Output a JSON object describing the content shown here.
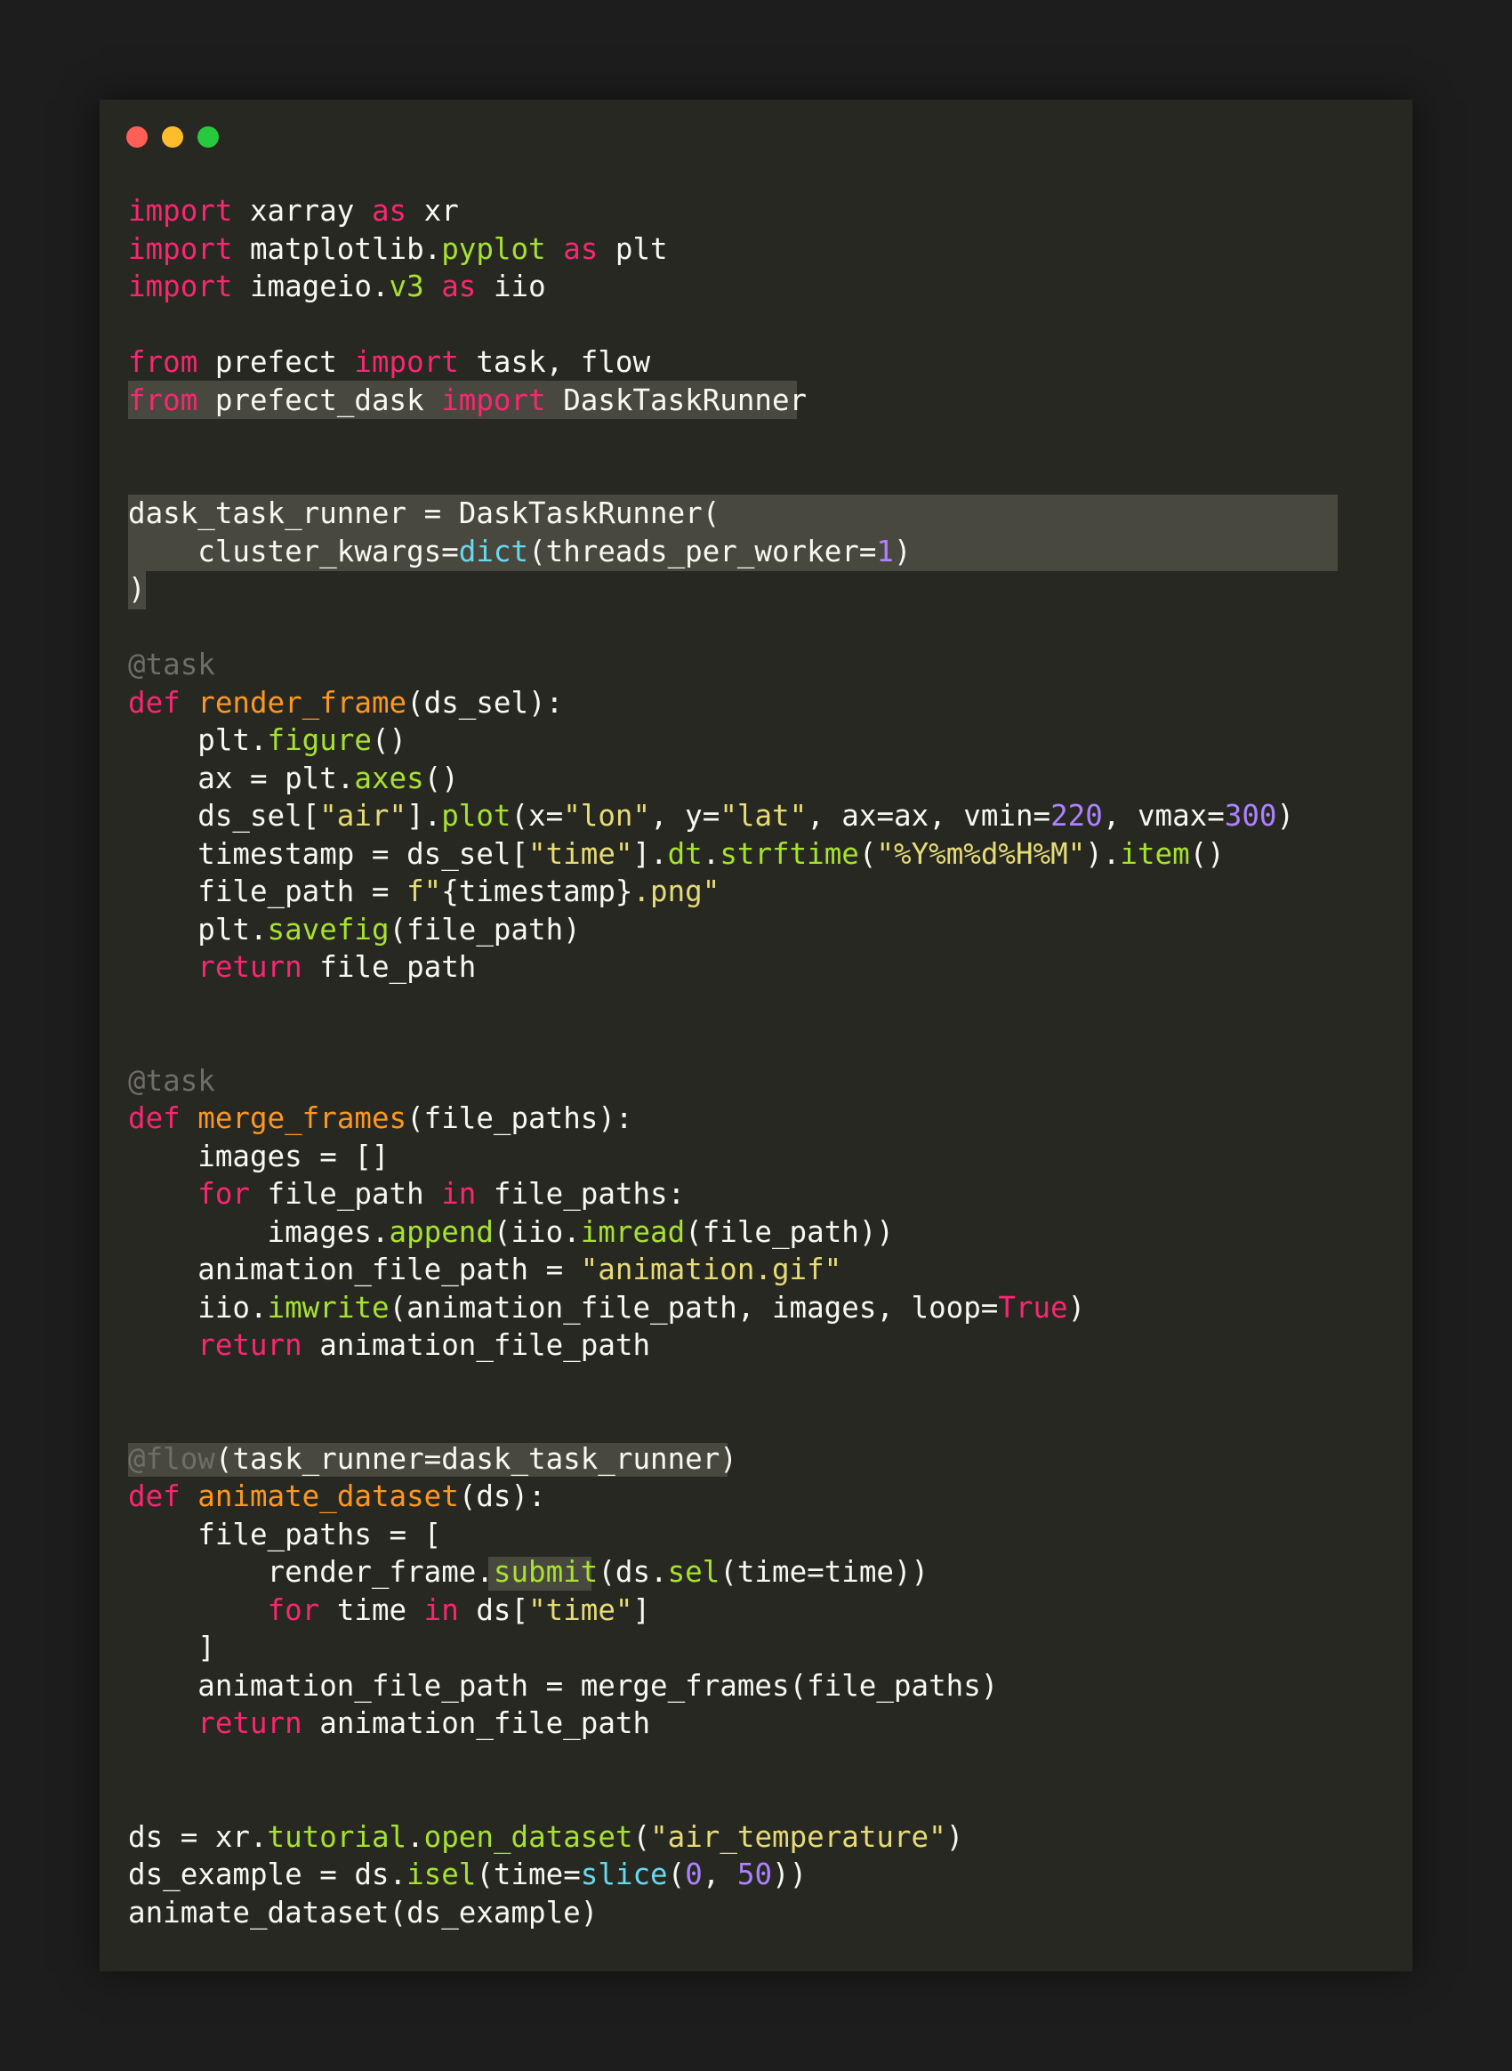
{
  "window": {
    "buttons": [
      "close",
      "minimize",
      "maximize"
    ],
    "colors": {
      "background": "#272822",
      "keyword": "#f92672",
      "function": "#fd971f",
      "attribute": "#a6e22e",
      "string": "#e6db74",
      "number": "#ae81ff",
      "builtin": "#66d9ef",
      "decorator": "#6e6e66",
      "highlight": "#49483e"
    }
  },
  "code": {
    "lines": [
      [
        [
          "kw",
          "import"
        ],
        [
          "p",
          " xarray "
        ],
        [
          "kw",
          "as"
        ],
        [
          "p",
          " xr"
        ]
      ],
      [
        [
          "kw",
          "import"
        ],
        [
          "p",
          " matplotlib."
        ],
        [
          "att",
          "pyplot"
        ],
        [
          "p",
          " "
        ],
        [
          "kw",
          "as"
        ],
        [
          "p",
          " plt"
        ]
      ],
      [
        [
          "kw",
          "import"
        ],
        [
          "p",
          " imageio."
        ],
        [
          "att",
          "v3"
        ],
        [
          "p",
          " "
        ],
        [
          "kw",
          "as"
        ],
        [
          "p",
          " iio"
        ]
      ],
      [],
      [
        [
          "kw",
          "from"
        ],
        [
          "p",
          " prefect "
        ],
        [
          "kw",
          "import"
        ],
        [
          "p",
          " task, flow"
        ]
      ],
      [
        [
          "kw",
          "from"
        ],
        [
          "p",
          " prefect_dask "
        ],
        [
          "kw",
          "import"
        ],
        [
          "p",
          " DaskTaskRunner"
        ]
      ],
      [],
      [],
      [
        [
          "p",
          "dask_task_runner = DaskTaskRunner("
        ]
      ],
      [
        [
          "p",
          "    cluster_kwargs="
        ],
        [
          "bi",
          "dict"
        ],
        [
          "p",
          "(threads_per_worker="
        ],
        [
          "num",
          "1"
        ],
        [
          "p",
          ")"
        ]
      ],
      [
        [
          "p",
          ")"
        ]
      ],
      [],
      [
        [
          "dec",
          "@task"
        ]
      ],
      [
        [
          "kw",
          "def"
        ],
        [
          "p",
          " "
        ],
        [
          "fn",
          "render_frame"
        ],
        [
          "p",
          "(ds_sel):"
        ]
      ],
      [
        [
          "p",
          "    plt."
        ],
        [
          "att",
          "figure"
        ],
        [
          "p",
          "()"
        ]
      ],
      [
        [
          "p",
          "    ax = plt."
        ],
        [
          "att",
          "axes"
        ],
        [
          "p",
          "()"
        ]
      ],
      [
        [
          "p",
          "    ds_sel["
        ],
        [
          "str",
          "\"air\""
        ],
        [
          "p",
          "]."
        ],
        [
          "att",
          "plot"
        ],
        [
          "p",
          "(x="
        ],
        [
          "str",
          "\"lon\""
        ],
        [
          "p",
          ", y="
        ],
        [
          "str",
          "\"lat\""
        ],
        [
          "p",
          ", ax=ax, vmin="
        ],
        [
          "num",
          "220"
        ],
        [
          "p",
          ", vmax="
        ],
        [
          "num",
          "300"
        ],
        [
          "p",
          ")"
        ]
      ],
      [
        [
          "p",
          "    timestamp = ds_sel["
        ],
        [
          "str",
          "\"time\""
        ],
        [
          "p",
          "]."
        ],
        [
          "att",
          "dt"
        ],
        [
          "p",
          "."
        ],
        [
          "att",
          "strftime"
        ],
        [
          "p",
          "("
        ],
        [
          "str",
          "\"%Y%m%d%H%M\""
        ],
        [
          "p",
          ")."
        ],
        [
          "att",
          "item"
        ],
        [
          "p",
          "()"
        ]
      ],
      [
        [
          "p",
          "    file_path = "
        ],
        [
          "str",
          "f\""
        ],
        [
          "p",
          "{timestamp}"
        ],
        [
          "str",
          ".png\""
        ]
      ],
      [
        [
          "p",
          "    plt."
        ],
        [
          "att",
          "savefig"
        ],
        [
          "p",
          "(file_path)"
        ]
      ],
      [
        [
          "p",
          "    "
        ],
        [
          "kw",
          "return"
        ],
        [
          "p",
          " file_path"
        ]
      ],
      [],
      [],
      [
        [
          "dec",
          "@task"
        ]
      ],
      [
        [
          "kw",
          "def"
        ],
        [
          "p",
          " "
        ],
        [
          "fn",
          "merge_frames"
        ],
        [
          "p",
          "(file_paths):"
        ]
      ],
      [
        [
          "p",
          "    images = []"
        ]
      ],
      [
        [
          "p",
          "    "
        ],
        [
          "kw",
          "for"
        ],
        [
          "p",
          " file_path "
        ],
        [
          "kw",
          "in"
        ],
        [
          "p",
          " file_paths:"
        ]
      ],
      [
        [
          "p",
          "        images."
        ],
        [
          "att",
          "append"
        ],
        [
          "p",
          "(iio."
        ],
        [
          "att",
          "imread"
        ],
        [
          "p",
          "(file_path))"
        ]
      ],
      [
        [
          "p",
          "    animation_file_path = "
        ],
        [
          "str",
          "\"animation.gif\""
        ]
      ],
      [
        [
          "p",
          "    iio."
        ],
        [
          "att",
          "imwrite"
        ],
        [
          "p",
          "(animation_file_path, images, loop="
        ],
        [
          "kw",
          "True"
        ],
        [
          "p",
          ")"
        ]
      ],
      [
        [
          "p",
          "    "
        ],
        [
          "kw",
          "return"
        ],
        [
          "p",
          " animation_file_path"
        ]
      ],
      [],
      [],
      [
        [
          "dec",
          "@flow"
        ],
        [
          "p",
          "(task_runner=dask_task_runner)"
        ]
      ],
      [
        [
          "kw",
          "def"
        ],
        [
          "p",
          " "
        ],
        [
          "fn",
          "animate_dataset"
        ],
        [
          "p",
          "(ds):"
        ]
      ],
      [
        [
          "p",
          "    file_paths = ["
        ]
      ],
      [
        [
          "p",
          "        render_frame."
        ],
        [
          "att",
          "submit"
        ],
        [
          "p",
          "(ds."
        ],
        [
          "att",
          "sel"
        ],
        [
          "p",
          "(time=time))"
        ]
      ],
      [
        [
          "p",
          "        "
        ],
        [
          "kw",
          "for"
        ],
        [
          "p",
          " time "
        ],
        [
          "kw",
          "in"
        ],
        [
          "p",
          " ds["
        ],
        [
          "str",
          "\"time\""
        ],
        [
          "p",
          "]"
        ]
      ],
      [
        [
          "p",
          "    ]"
        ]
      ],
      [
        [
          "p",
          "    animation_file_path = merge_frames(file_paths)"
        ]
      ],
      [
        [
          "p",
          "    "
        ],
        [
          "kw",
          "return"
        ],
        [
          "p",
          " animation_file_path"
        ]
      ],
      [],
      [],
      [
        [
          "p",
          "ds = xr."
        ],
        [
          "att",
          "tutorial"
        ],
        [
          "p",
          "."
        ],
        [
          "att",
          "open_dataset"
        ],
        [
          "p",
          "("
        ],
        [
          "str",
          "\"air_temperature\""
        ],
        [
          "p",
          ")"
        ]
      ],
      [
        [
          "p",
          "ds_example = ds."
        ],
        [
          "att",
          "isel"
        ],
        [
          "p",
          "(time="
        ],
        [
          "bi",
          "slice"
        ],
        [
          "p",
          "("
        ],
        [
          "num",
          "0"
        ],
        [
          "p",
          ", "
        ],
        [
          "num",
          "50"
        ],
        [
          "p",
          "))"
        ]
      ],
      [
        [
          "p",
          "animate_dataset(ds_example)"
        ]
      ]
    ]
  }
}
